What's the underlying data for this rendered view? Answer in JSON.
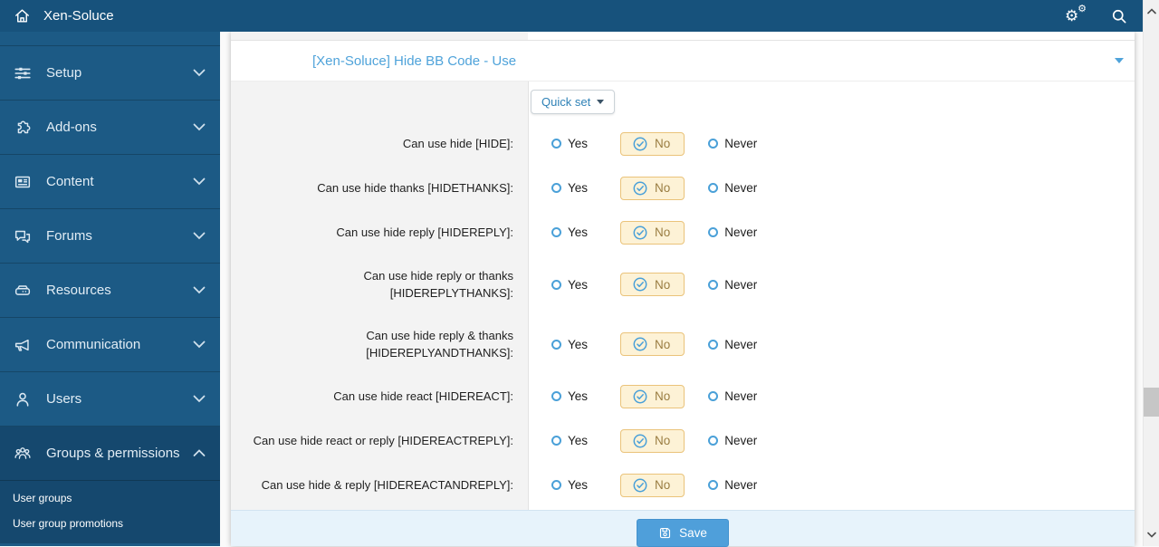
{
  "topbar": {
    "title": "Xen-Soluce"
  },
  "sidebar": {
    "items": [
      {
        "label": "Setup"
      },
      {
        "label": "Add-ons"
      },
      {
        "label": "Content"
      },
      {
        "label": "Forums"
      },
      {
        "label": "Resources"
      },
      {
        "label": "Communication"
      },
      {
        "label": "Users"
      },
      {
        "label": "Groups & permissions"
      }
    ],
    "subitems": [
      {
        "label": "User groups"
      },
      {
        "label": "User group promotions"
      }
    ]
  },
  "panel": {
    "title": "[Xen-Soluce] Hide BB Code - Use",
    "quick_set_label": "Quick set",
    "options": {
      "yes": "Yes",
      "no": "No",
      "never": "Never"
    },
    "rows": [
      {
        "label": "Can use hide [HIDE]:",
        "selected": "No"
      },
      {
        "label": "Can use hide thanks [HIDETHANKS]:",
        "selected": "No"
      },
      {
        "label": "Can use hide reply [HIDEREPLY]:",
        "selected": "No"
      },
      {
        "label": "Can use hide reply or thanks [HIDEREPLYTHANKS]:",
        "selected": "No"
      },
      {
        "label": "Can use hide reply & thanks [HIDEREPLYANDTHANKS]:",
        "selected": "No"
      },
      {
        "label": "Can use hide react [HIDEREACT]:",
        "selected": "No"
      },
      {
        "label": "Can use hide react or reply [HIDEREACTREPLY]:",
        "selected": "No"
      },
      {
        "label": "Can use hide & reply [HIDEREACTANDREPLY]:",
        "selected": "No"
      }
    ],
    "save_label": "Save"
  },
  "colors": {
    "topbar_bg": "#17527C",
    "sidebar_bg": "#1C5A85",
    "sidebar_expanded_bg": "#15486E",
    "accent_blue": "#4FA3DA",
    "pill_bg": "#FDF2D6",
    "pill_border": "#EAC37A",
    "pill_text": "#9A7D42",
    "footer_bg": "#E7F3FB",
    "save_button_bg": "#4F9FDA"
  }
}
